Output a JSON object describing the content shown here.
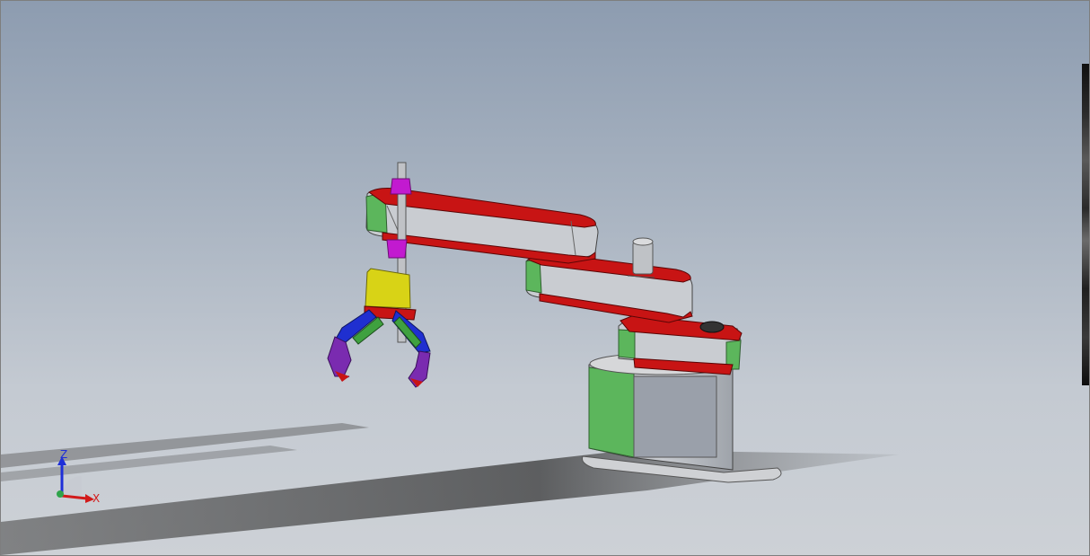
{
  "triad": {
    "z_label": "Z",
    "x_label": "X"
  },
  "colors": {
    "link_red": "#c81414",
    "joint_green": "#5cb65c",
    "housing_gray": "#c7c9cc",
    "gripper_yellow": "#d8d316",
    "gripper_blue": "#1f2fd0",
    "gripper_purple": "#7a2bb0",
    "shaft_magenta": "#c21ad0"
  },
  "icons": {
    "triad": "coordinate-triad-icon"
  }
}
